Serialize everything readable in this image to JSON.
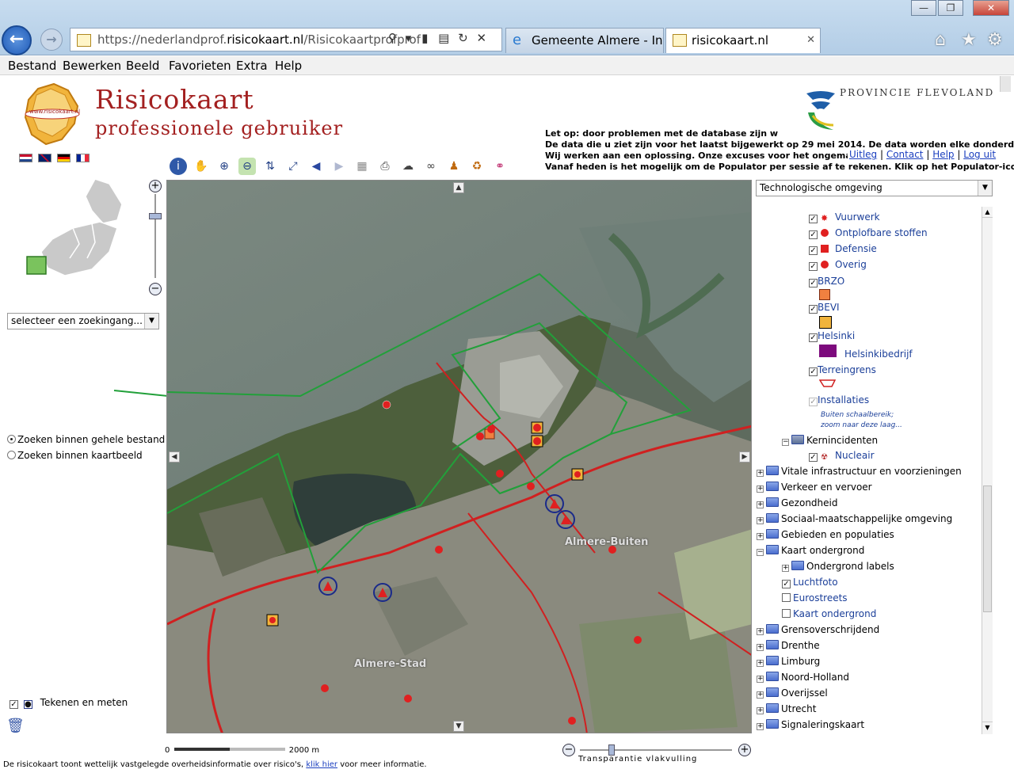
{
  "browser": {
    "url_prefix": "https://nederlandprof.",
    "url_domain": "risicokaart.nl",
    "url_rest": "/Risicokaartprofprof",
    "tabs": [
      {
        "label": "Gemeente Almere - Int..."
      },
      {
        "label": "risicokaart.nl"
      }
    ],
    "close_tab": "✕"
  },
  "menu": [
    "Bestand",
    "Bewerken",
    "Beeld",
    "Favorieten",
    "Extra",
    "Help"
  ],
  "header": {
    "logo_text": "www.risicokaart.nl",
    "title_line1": "Risicokaart",
    "title_line2": "professionele gebruiker",
    "province": "Provincie Flevoland"
  },
  "notice": {
    "line1": "Let op: door problemen met de database zijn w",
    "line2": "De data die u ziet zijn voor het laatst bijgewerkt op 29 mei 2014. De data worden elke donderdagnacht ge",
    "line3": "Wij werken aan een oplossing. Onze excuses voor het ongemak.",
    "line4": "Vanaf heden is het mogelijk om de Populator per sessie af te rekenen. Klik op het Populator-icoontje vo"
  },
  "links": [
    "Uitleg",
    "Contact",
    "Help",
    "Log uit"
  ],
  "left_panel": {
    "search_select": "selecteer  een zoekingang...",
    "radio_options": [
      {
        "label": "Zoeken binnen gehele bestand",
        "checked": true
      },
      {
        "label": "Zoeken binnen kaartbeeld",
        "checked": false
      }
    ],
    "draw_label": "Tekenen en meten"
  },
  "map": {
    "labels": [
      "Almere-Buiten",
      "Almere-Stad"
    ]
  },
  "scale": {
    "start": "0",
    "end": "2000 m"
  },
  "transparency_label": "Transparantie vlakvulling",
  "layer_panel": {
    "select": "Technologische omgeving",
    "items": [
      {
        "label": "Vuurwerk",
        "checked": true
      },
      {
        "label": "Ontplofbare stoffen",
        "checked": true
      },
      {
        "label": "Defensie",
        "checked": true
      },
      {
        "label": "Overig",
        "checked": true
      },
      {
        "label": "BRZO",
        "checked": true
      },
      {
        "label": "BEVI",
        "checked": true
      },
      {
        "label": "Helsinki",
        "checked": true
      },
      {
        "label": "Helsinkibedrijf"
      },
      {
        "label": "Terreingrens",
        "checked": true
      },
      {
        "label": "Installaties",
        "checked": true
      },
      {
        "label": "Buiten schaalbereik;"
      },
      {
        "label": "zoom naar deze laag..."
      },
      {
        "label": "Kernincidenten"
      },
      {
        "label": "Nucleair",
        "checked": true
      },
      {
        "label": "Vitale infrastructuur en voorzieningen"
      },
      {
        "label": "Verkeer en vervoer"
      },
      {
        "label": "Gezondheid"
      },
      {
        "label": "Sociaal-maatschappelijke omgeving"
      },
      {
        "label": "Gebieden en populaties"
      },
      {
        "label": "Kaart ondergrond"
      },
      {
        "label": "Ondergrond labels"
      },
      {
        "label": "Luchtfoto",
        "checked": true
      },
      {
        "label": "Eurostreets",
        "checked": false
      },
      {
        "label": "Kaart ondergrond",
        "checked": false
      },
      {
        "label": "Grensoverschrijdend"
      },
      {
        "label": "Drenthe"
      },
      {
        "label": "Limburg"
      },
      {
        "label": "Noord-Holland"
      },
      {
        "label": "Overijssel"
      },
      {
        "label": "Utrecht"
      },
      {
        "label": "Signaleringskaart"
      }
    ]
  },
  "footer": {
    "text": "De risicokaart toont wettelijk vastgelegde overheidsinformatie over risico's,",
    "link": "klik hier",
    "text2": "voor meer informatie."
  },
  "colors": {
    "title": "#a32020",
    "link": "#1b3fbf",
    "boundary": "#22a03a",
    "route": "#d02020"
  }
}
